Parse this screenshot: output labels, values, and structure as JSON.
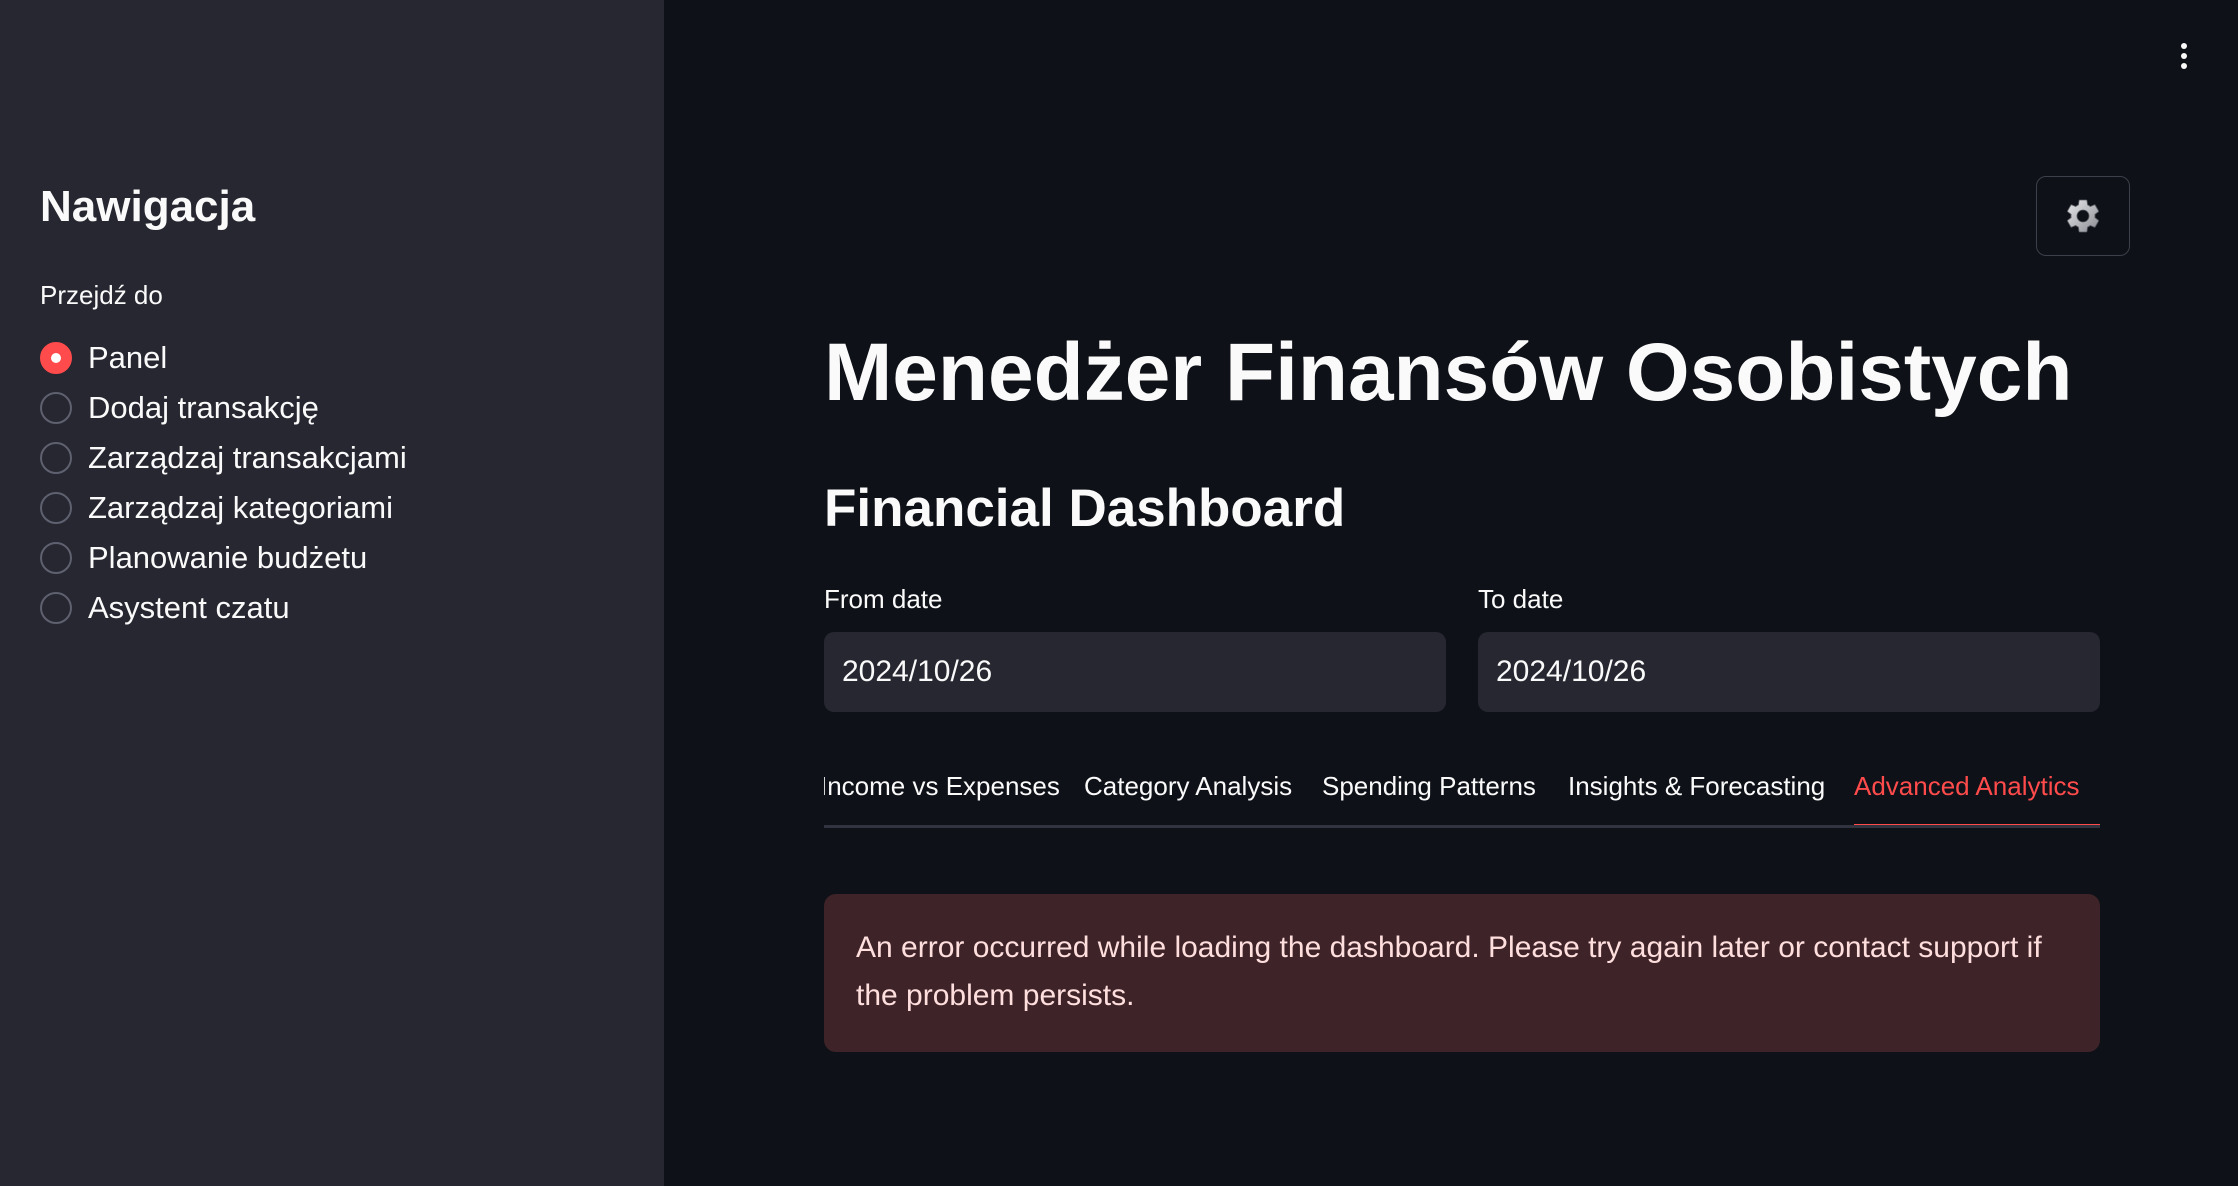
{
  "sidebar": {
    "title": "Nawigacja",
    "radio_label": "Przejdź do",
    "items": [
      {
        "label": "Panel",
        "selected": true
      },
      {
        "label": "Dodaj transakcję",
        "selected": false
      },
      {
        "label": "Zarządzaj transakcjami",
        "selected": false
      },
      {
        "label": "Zarządzaj kategoriami",
        "selected": false
      },
      {
        "label": "Planowanie budżetu",
        "selected": false
      },
      {
        "label": "Asystent czatu",
        "selected": false
      }
    ]
  },
  "header": {
    "menu_icon": "more-vertical-icon",
    "settings_icon": "gear-icon"
  },
  "main": {
    "title": "Menedżer Finansów Osobistych",
    "subtitle": "Financial Dashboard",
    "from_date": {
      "label": "From date",
      "value": "2024/10/26"
    },
    "to_date": {
      "label": "To date",
      "value": "2024/10/26"
    },
    "tabs": [
      {
        "label": "Income vs Expenses",
        "active": false
      },
      {
        "label": "Category Analysis",
        "active": false
      },
      {
        "label": "Spending Patterns",
        "active": false
      },
      {
        "label": "Insights & Forecasting",
        "active": false
      },
      {
        "label": "Advanced Analytics",
        "active": true
      }
    ],
    "error_message": "An error occurred while loading the dashboard. Please try again later or contact support if the problem persists."
  },
  "colors": {
    "accent": "#ff4b4b",
    "background": "#0e1117",
    "sidebar": "#262730",
    "error_background": "#3e2428"
  }
}
